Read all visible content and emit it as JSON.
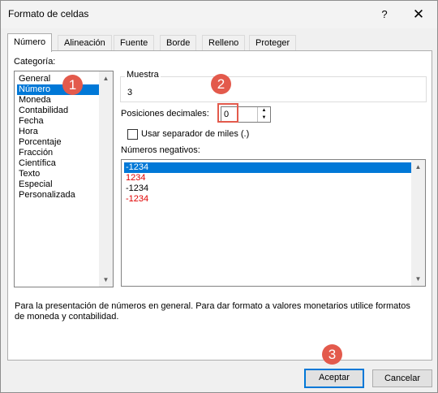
{
  "window": {
    "title": "Formato de celdas",
    "help_label": "?",
    "close_label": "✕"
  },
  "tabs": [
    "Número",
    "Alineación",
    "Fuente",
    "Borde",
    "Relleno",
    "Proteger"
  ],
  "category": {
    "label": "Categoría:",
    "items": [
      "General",
      "Número",
      "Moneda",
      "Contabilidad",
      "Fecha",
      "Hora",
      "Porcentaje",
      "Fracción",
      "Científica",
      "Texto",
      "Especial",
      "Personalizada"
    ],
    "selected": "Número"
  },
  "sample": {
    "label": "Muestra",
    "value": "3"
  },
  "decimals": {
    "label": "Posiciones decimales:",
    "value": "0"
  },
  "thousands": {
    "label": "Usar separador de miles (.)",
    "checked": false
  },
  "negatives": {
    "label": "Números negativos:",
    "items": [
      "-1234",
      "1234",
      "-1234",
      "-1234"
    ],
    "colors": [
      "#ffffff",
      "#e00000",
      "#000000",
      "#e00000"
    ],
    "selected_index": 0
  },
  "description": "Para la presentación de números en general. Para dar formato a valores monetarios utilice formatos de moneda y contabilidad.",
  "buttons": {
    "ok": "Aceptar",
    "cancel": "Cancelar"
  },
  "callouts": [
    "1",
    "2",
    "3"
  ],
  "colors": {
    "accent": "#0078d7",
    "callout": "#e35a4c",
    "negative_red": "#e00000"
  }
}
